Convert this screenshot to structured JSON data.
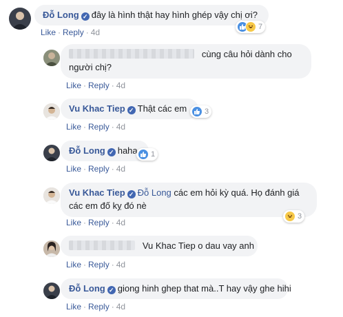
{
  "actions": {
    "like": "Like",
    "reply": "Reply",
    "sep": "·"
  },
  "comments": [
    {
      "author": "Đỗ Long",
      "verified": true,
      "text": "đây là hình thật hay hình ghép vậy chị ơi?",
      "time": "4d",
      "reaction_count": "7",
      "reactions": [
        "like-icon",
        "haha-icon"
      ]
    },
    {
      "author_hidden": true,
      "text_line1": "cùng câu hỏi dành cho",
      "text_line2": "người chị?",
      "time": "4d"
    },
    {
      "author": "Vu Khac Tiep",
      "verified": true,
      "text": "Thật các em",
      "time": "4d",
      "reaction_count": "3",
      "reactions": [
        "like-icon"
      ]
    },
    {
      "author": "Đỗ Long",
      "verified": true,
      "text": "haha",
      "time": "4d",
      "reaction_count": "1",
      "reactions": [
        "like-icon"
      ]
    },
    {
      "author": "Vu Khac Tiep",
      "verified": true,
      "mention": "Đỗ Long",
      "text_line1": "các em hỏi kỳ quá. Họ đánh giá",
      "text_line2": "các em đố kỵ đó nè",
      "time": "4d",
      "reaction_count": "3",
      "reactions": [
        "haha-icon"
      ]
    },
    {
      "author_hidden": true,
      "text": "Vu Khac Tiep o dau vay anh",
      "time": "4d"
    },
    {
      "author": "Đỗ Long",
      "verified": true,
      "text": "giong hinh ghep that mà..T hay vậy ghe hihi",
      "time": "4d"
    }
  ],
  "colors": {
    "link": "#385898",
    "bubble": "#f2f3f5",
    "like_reaction": "#4a90e2",
    "haha_reaction": "#f7c948"
  }
}
